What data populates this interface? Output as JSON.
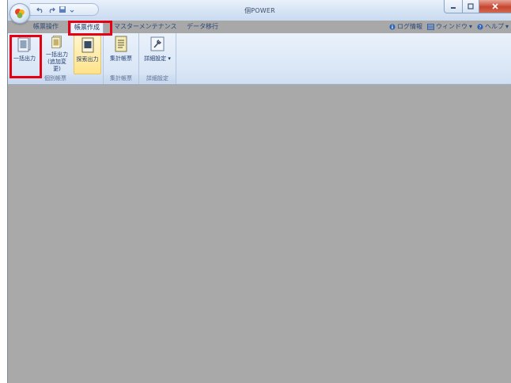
{
  "window": {
    "title": "個POWER"
  },
  "quick_access": [
    "undo-icon",
    "redo-icon",
    "save-icon",
    "customize-qat-icon"
  ],
  "tabs": [
    {
      "label": "帳票操作",
      "active": false
    },
    {
      "label": "帳票作成",
      "active": true
    },
    {
      "label": "マスターメンテナンス",
      "active": false
    },
    {
      "label": "データ移行",
      "active": false
    }
  ],
  "right_menu": {
    "log": "ログ情報",
    "window": "ウィンドウ",
    "help": "ヘルプ"
  },
  "ribbon": {
    "groups": [
      {
        "label": "個別帳票",
        "buttons": [
          {
            "label": "一括出力"
          },
          {
            "label_line1": "一括出力",
            "label_line2": "(追加変更)"
          },
          {
            "label": "探索出力"
          }
        ]
      },
      {
        "label": "集計帳票",
        "buttons": [
          {
            "label": "集計帳票"
          }
        ]
      },
      {
        "label": "詳細設定",
        "buttons": [
          {
            "label": "詳細設定 ▾"
          }
        ]
      }
    ]
  },
  "colors": {
    "highlight": "#e60012",
    "content_bg": "#a9a9a9",
    "ribbon_bg": "#dbe7f6"
  }
}
